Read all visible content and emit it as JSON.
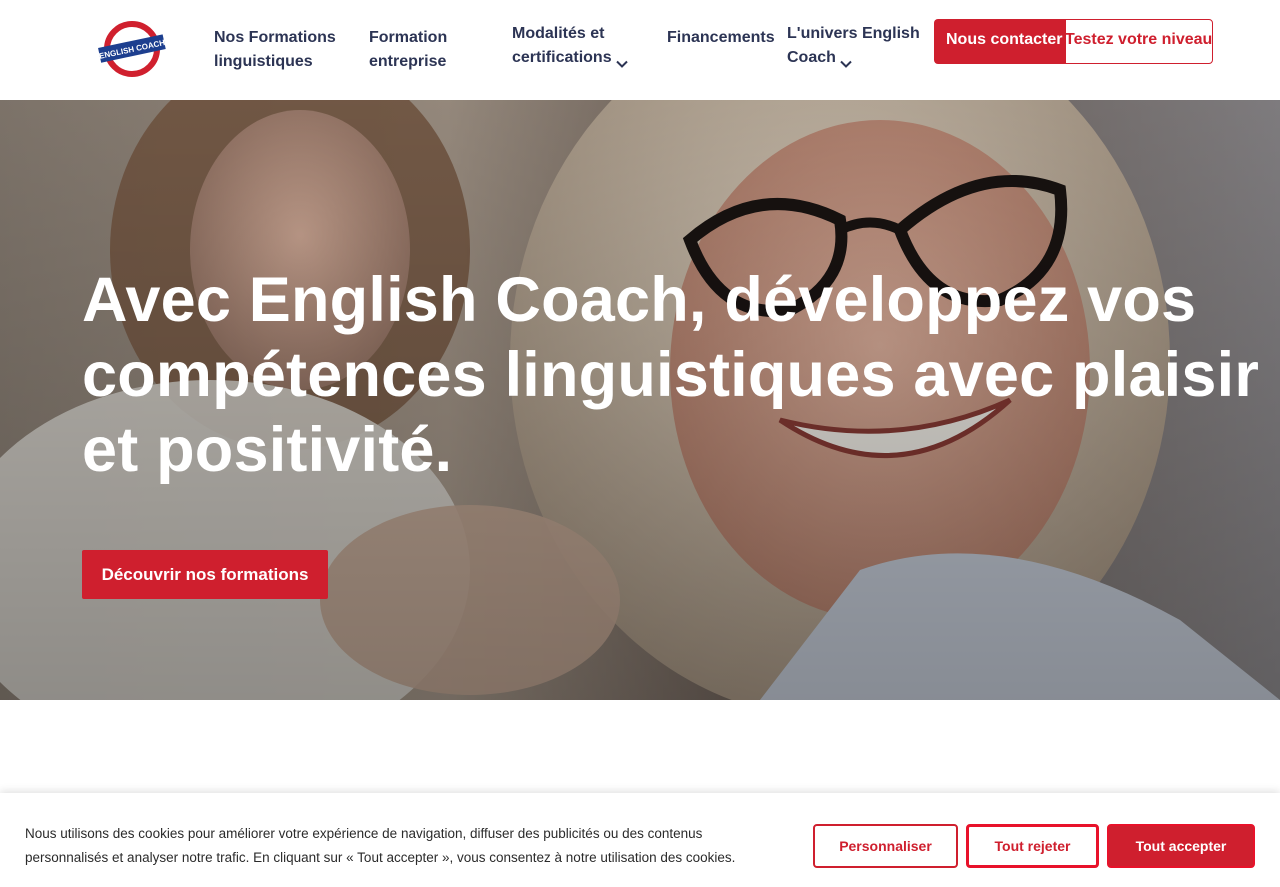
{
  "header": {
    "logo_text": "ENGLISH COACH",
    "nav": [
      {
        "label": "Nos Formations linguistiques",
        "has_dropdown": false
      },
      {
        "label": "Formation entreprise",
        "has_dropdown": false
      },
      {
        "label": "Modalités et certifications",
        "has_dropdown": true
      },
      {
        "label": "Financements",
        "has_dropdown": false
      },
      {
        "label": "L'univers English Coach",
        "has_dropdown": true
      }
    ],
    "contact_label": "Nous contacter",
    "test_label": "Testez votre niveau"
  },
  "hero": {
    "title": "Avec English Coach, développez vos compétences linguistiques avec plaisir et positivité.",
    "cta_label": "Découvrir nos formations"
  },
  "cookie": {
    "text": "Nous utilisons des cookies pour améliorer votre expérience de navigation, diffuser des publicités ou des contenus personnalisés et analyser notre trafic. En cliquant sur « Tout accepter », vous consentez à notre utilisation des cookies.",
    "customize_label": "Personnaliser",
    "reject_label": "Tout rejeter",
    "accept_label": "Tout accepter"
  },
  "colors": {
    "brand_red": "#cf1f2e",
    "nav_text": "#2c3454",
    "logo_blue": "#1d3f8f"
  },
  "icons": {
    "dropdown": "chevron-down-icon"
  }
}
